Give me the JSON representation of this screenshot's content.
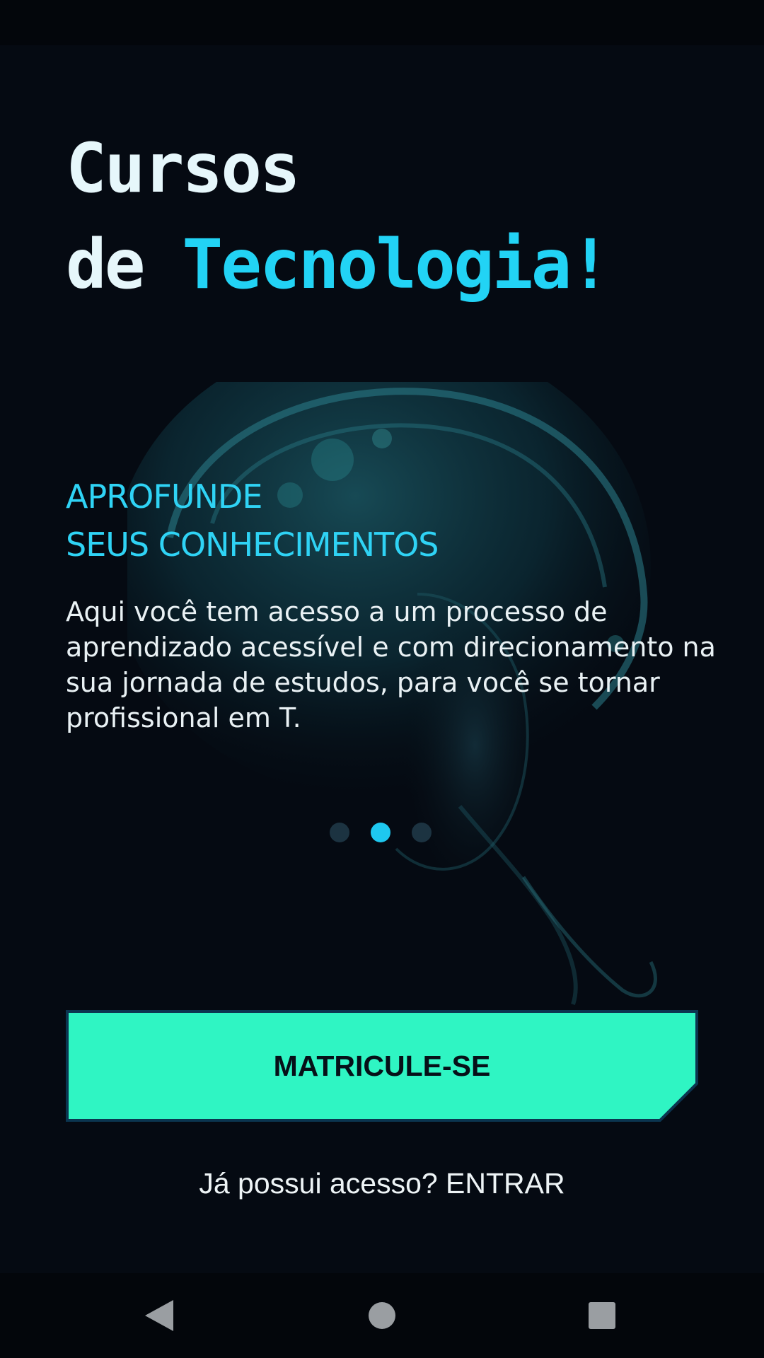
{
  "header": {
    "title_line1": "Cursos",
    "title_line2_prefix": "de ",
    "title_line2_accent": "Tecnologia!"
  },
  "slide": {
    "heading_line1": "APROFUNDE",
    "heading_line2": "SEUS CONHECIMENTOS",
    "body": "Aqui você tem acesso a um processo de aprendizado acessível e com direcionamento na sua jornada de estudos, para você se tornar profissional em T."
  },
  "carousel": {
    "total": 3,
    "active_index": 1
  },
  "actions": {
    "enroll_label": "MATRICULE-SE",
    "login_label": "Já possui acesso? ENTRAR"
  },
  "colors": {
    "background": "#050a12",
    "accent_cyan": "#22d3f5",
    "cta_green": "#2ff5c3",
    "text_light": "#e6f7fb"
  },
  "icons": {
    "hero": "astronaut-helmet-illustration",
    "nav_back": "back-triangle-icon",
    "nav_home": "home-circle-icon",
    "nav_recents": "recents-square-icon"
  }
}
